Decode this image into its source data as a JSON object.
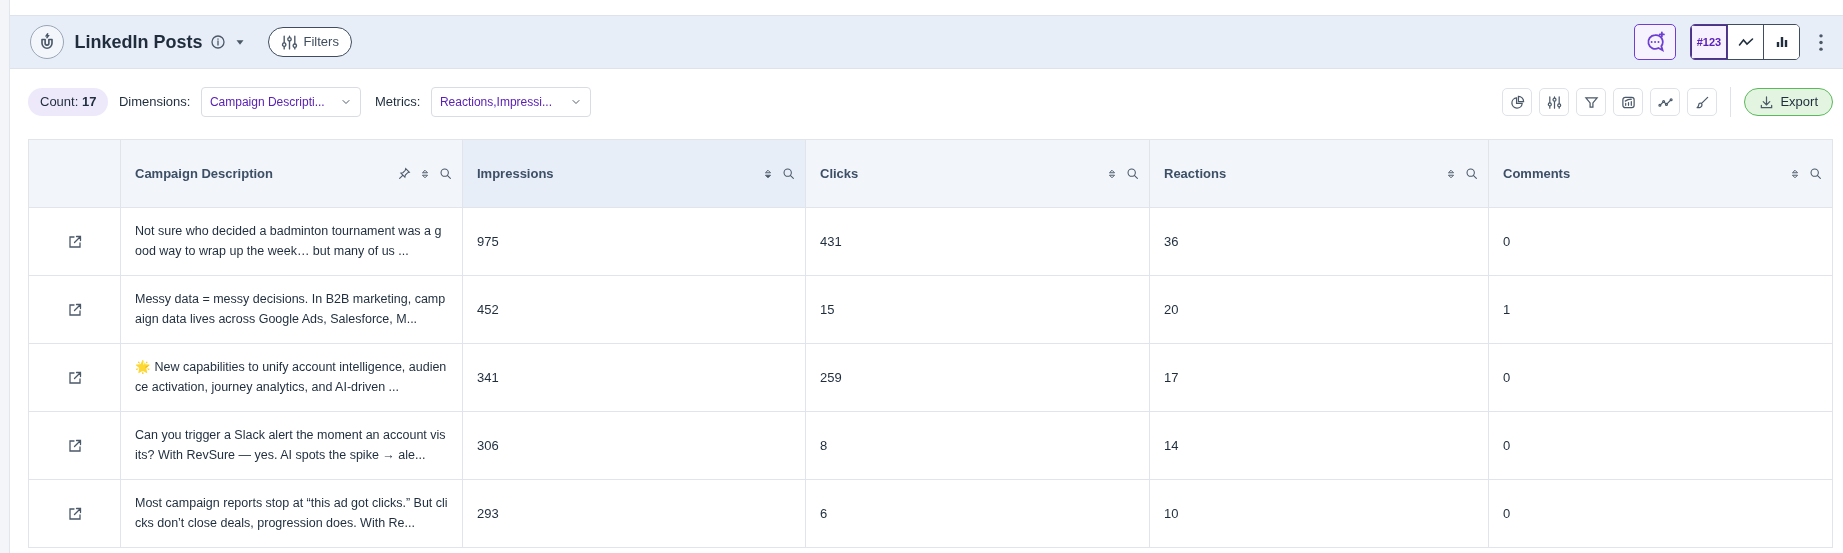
{
  "widget": {
    "title": "LinkedIn Posts",
    "filters_label": "Filters",
    "views": [
      {
        "kind": "number",
        "label": "#123",
        "selected": true
      },
      {
        "kind": "line",
        "selected": false
      },
      {
        "kind": "bar",
        "selected": false
      }
    ]
  },
  "toolbar": {
    "count": "Count: **17**",
    "dimensions_label": "Dimensions:",
    "dimensions_value": "Campaign Descripti...",
    "metrics_label": "Metrics:",
    "metrics_value": "Reactions,Impressi...",
    "export_label": "Export"
  },
  "table": {
    "columns": [
      {
        "label": "Campaign Description",
        "pinnable": true,
        "sorted": false
      },
      {
        "label": "Impressions",
        "pinnable": false,
        "sorted": true
      },
      {
        "label": "Clicks",
        "pinnable": false,
        "sorted": false
      },
      {
        "label": "Reactions",
        "pinnable": false,
        "sorted": false
      },
      {
        "label": "Comments",
        "pinnable": false,
        "sorted": false
      }
    ],
    "rows": [
      [
        "Not sure who decided a badminton tournament was a good way to wrap up the week… but many of us ...",
        "975",
        "431",
        "36",
        "0"
      ],
      [
        "Messy data = messy decisions. In B2B marketing, campaign data lives across Google Ads, Salesforce, M...",
        "452",
        "15",
        "20",
        "1"
      ],
      [
        "🌟 New capabilities to unify account intelligence, audience activation, journey analytics, and AI-driven ...",
        "341",
        "259",
        "17",
        "0"
      ],
      [
        "Can you trigger a Slack alert the moment an account visits? With RevSure — yes. AI spots the spike → ale...",
        "306",
        "8",
        "14",
        "0"
      ],
      [
        "Most campaign reports stop at “this ad got clicks.” But clicks don’t close deals, progression does. With Re...",
        "293",
        "6",
        "10",
        "0"
      ]
    ]
  }
}
